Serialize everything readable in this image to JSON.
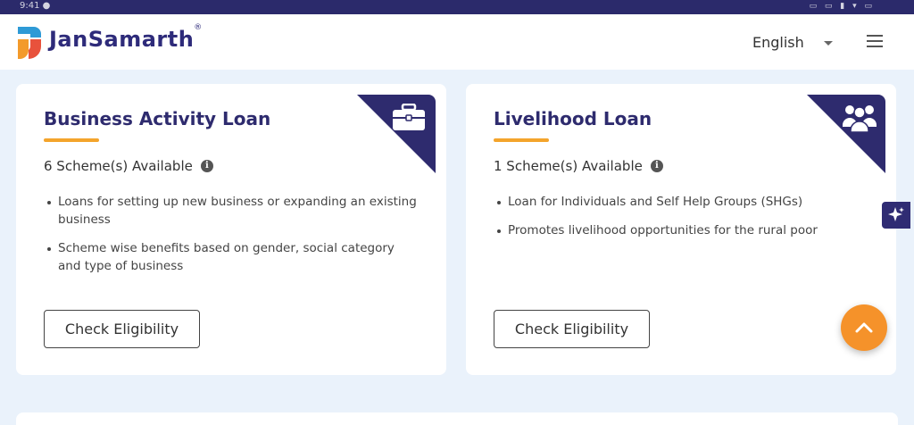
{
  "statusbar": {
    "left_text": "9:41 ●",
    "right_text": "▭ ▭ ▮ ▾ ▭"
  },
  "header": {
    "logo_text": "JanSamarth",
    "logo_reg": "®",
    "language": "English"
  },
  "cards": [
    {
      "title": "Business Activity Loan",
      "schemes": "6 Scheme(s) Available",
      "icon": "briefcase-icon",
      "bullets": [
        "Loans for setting up new business or expanding an existing business",
        "Scheme wise benefits based on gender, social category and type of business"
      ],
      "button": "Check Eligibility"
    },
    {
      "title": "Livelihood Loan",
      "schemes": "1 Scheme(s) Available",
      "icon": "group-icon",
      "bullets": [
        "Loan for Individuals and Self Help Groups (SHGs)",
        "Promotes livelihood opportunities for the rural poor"
      ],
      "button": "Check Eligibility"
    }
  ],
  "colors": {
    "brand": "#2e2b6e",
    "accent": "#f4a42c",
    "fab": "#f5922a",
    "background": "#eaf2fb"
  }
}
